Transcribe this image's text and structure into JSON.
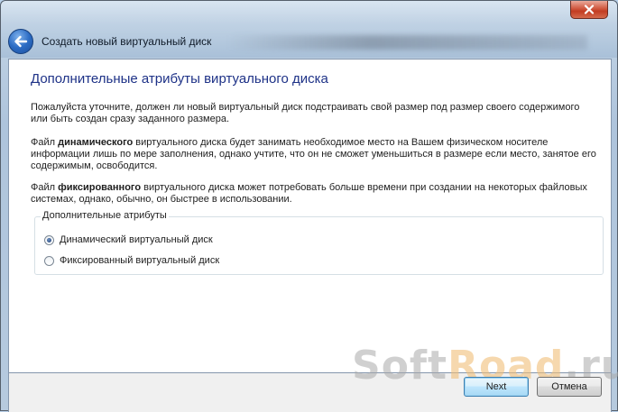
{
  "window": {
    "title": "Создать новый виртуальный диск"
  },
  "content": {
    "heading": "Дополнительные атрибуты виртуального диска",
    "para1": "Пожалуйста уточните, должен ли новый виртуальный диск подстраивать свой размер под размер своего содержимого или быть создан сразу заданного размера.",
    "para2": {
      "prefix": "Файл ",
      "bold": "динамического",
      "rest": " виртуального диска будет занимать необходимое место на Вашем физическом носителе информации лишь по мере заполнения, однако учтите, что он не сможет уменьшиться в размере если место, занятое его содержимым, освободится."
    },
    "para3": {
      "prefix": "Файл ",
      "bold": "фиксированного",
      "rest": " виртуального диска может потребовать больше времени при создании на некоторых файловых системах, однако, обычно, он быстрее в использовании."
    }
  },
  "group": {
    "label": "Дополнительные атрибуты",
    "options": [
      {
        "label": "Динамический виртуальный диск",
        "selected": true
      },
      {
        "label": "Фиксированный виртуальный диск",
        "selected": false
      }
    ]
  },
  "buttons": {
    "next": "Next",
    "cancel": "Отмена"
  },
  "watermark": {
    "part1": "Soft",
    "part2": "Road",
    "part3": ".ru"
  },
  "icons": {
    "back": "back-arrow-icon",
    "close": "close-icon"
  }
}
